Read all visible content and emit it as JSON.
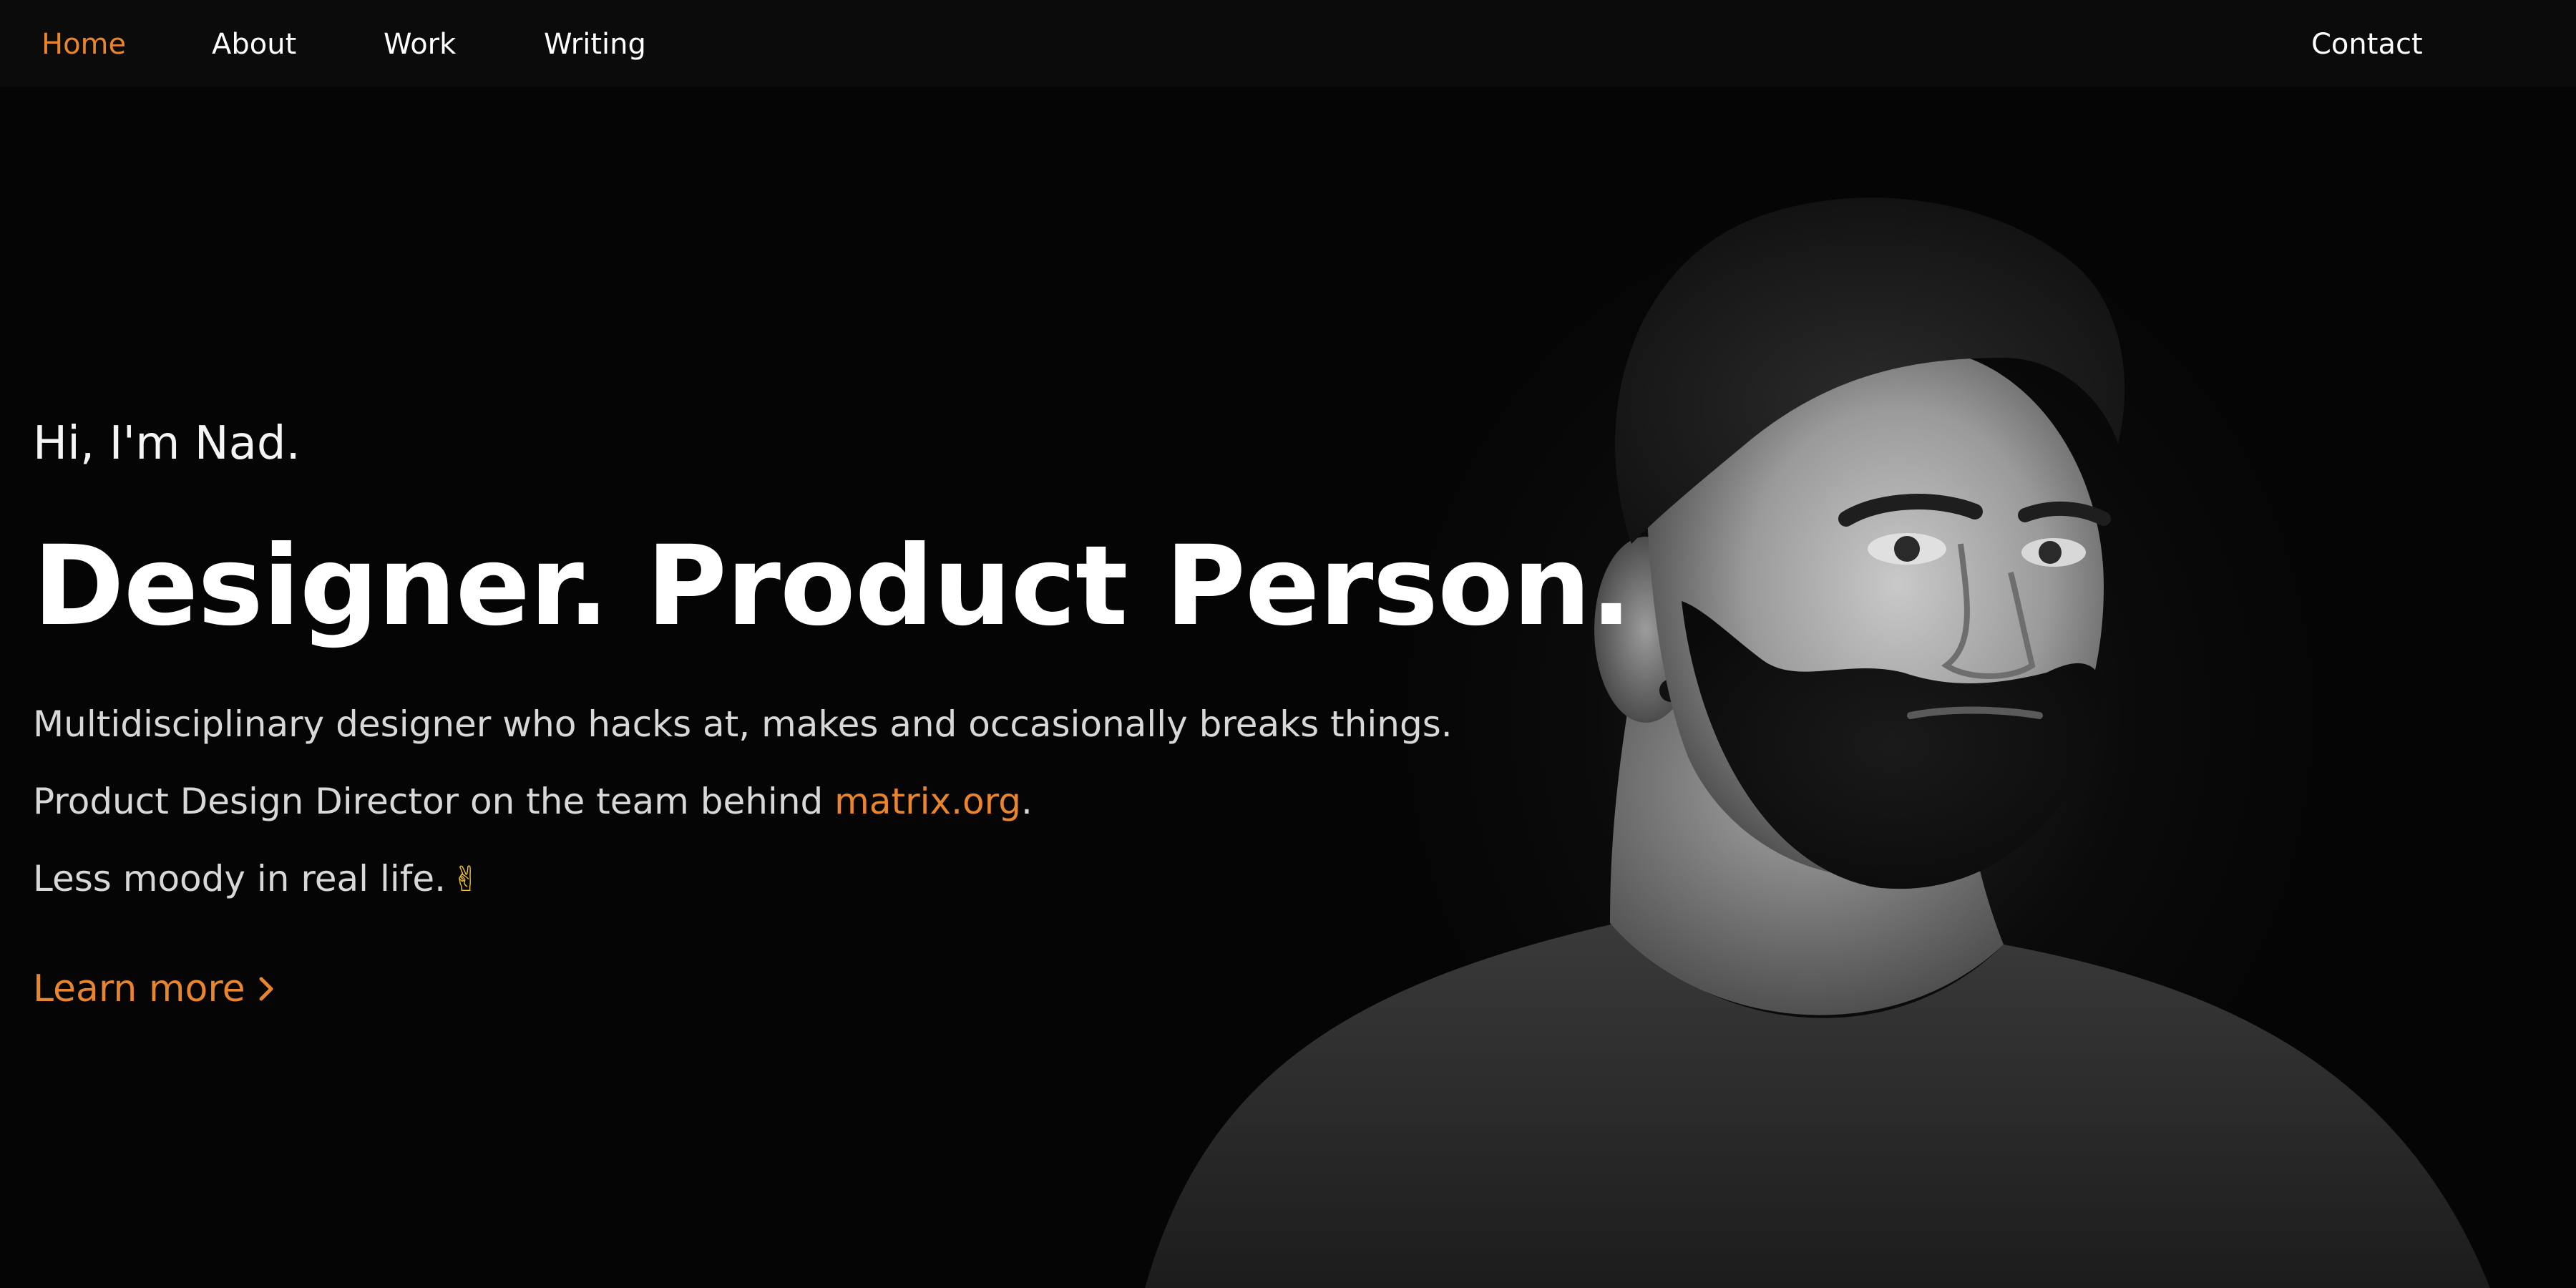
{
  "nav": {
    "items": [
      {
        "label": "Home",
        "active": true
      },
      {
        "label": "About",
        "active": false
      },
      {
        "label": "Work",
        "active": false
      },
      {
        "label": "Writing",
        "active": false
      }
    ],
    "contact": "Contact"
  },
  "hero": {
    "greeting": "Hi, I'm Nad.",
    "headline": "Designer. Product Person.",
    "line1": "Multidisciplinary designer who hacks at, makes and occasionally breaks things.",
    "line2_prefix": "Product Design Director on the team behind ",
    "line2_link": "matrix.org",
    "line2_suffix": ".",
    "line3": "Less moody in real life.",
    "line3_emoji": "✌",
    "learn_more": "Learn more"
  },
  "colors": {
    "accent": "#e8852d",
    "background": "#050505",
    "nav_background": "#0b0b0b",
    "text": "#ffffff"
  },
  "icons": {
    "learn_more": "chevron-right-icon",
    "emoji": "victory-hand-icon"
  },
  "portrait": {
    "subject": "black-and-white portrait photo"
  }
}
